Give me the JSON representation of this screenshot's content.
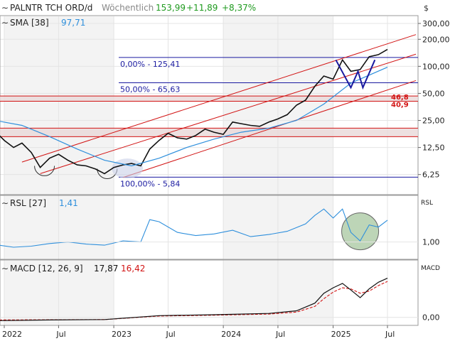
{
  "header": {
    "title": "PALNTR TCH ORD/d",
    "interval": "Wöchentlich",
    "price": "153,99",
    "change": "+11,89",
    "change_pct": "+8,37%",
    "currency": "$"
  },
  "colors": {
    "price": "#111111",
    "sma": "#2e8fdc",
    "channel": "#d21414",
    "fib": "#1a1aa0",
    "support_zone": "#e8d8d8",
    "rsl": "#2e8fdc",
    "macd": "#111111",
    "signal": "#d21414",
    "green": "#1e9a1e",
    "grid": "#e4e4e4"
  },
  "chart_data": [
    {
      "type": "line",
      "panel": "price",
      "scale": "log",
      "y_ticks": [
        6.25,
        12.5,
        25,
        50,
        100,
        200,
        300
      ],
      "y_tick_labels": [
        "6,25",
        "12,50",
        "25,00",
        "50,00",
        "100,00",
        "200,00",
        "300,00"
      ],
      "x_ticks": [
        "2022",
        "Jul",
        "2023",
        "Jul",
        "2024",
        "Jul",
        "2025",
        "Jul"
      ],
      "x_tick_dates": [
        "2022-01-01",
        "2022-07-01",
        "2023-01-01",
        "2023-07-01",
        "2024-01-01",
        "2024-07-01",
        "2025-01-01",
        "2025-07-01"
      ],
      "grid": true,
      "series": [
        {
          "name": "PALNTR TCH ORD/d",
          "x": [
            "2021-12-01",
            "2022-01-01",
            "2022-02-01",
            "2022-03-01",
            "2022-04-01",
            "2022-05-01",
            "2022-06-01",
            "2022-07-01",
            "2022-08-01",
            "2022-09-01",
            "2022-10-01",
            "2022-11-01",
            "2022-12-01",
            "2023-01-01",
            "2023-02-01",
            "2023-03-01",
            "2023-04-01",
            "2023-05-01",
            "2023-06-01",
            "2023-07-01",
            "2023-08-01",
            "2023-09-01",
            "2023-10-01",
            "2023-11-01",
            "2023-12-01",
            "2024-01-01",
            "2024-02-01",
            "2024-03-01",
            "2024-04-01",
            "2024-05-01",
            "2024-06-01",
            "2024-07-01",
            "2024-08-01",
            "2024-09-01",
            "2024-10-01",
            "2024-11-01",
            "2024-12-01",
            "2025-01-01",
            "2025-02-01",
            "2025-03-01",
            "2025-04-01",
            "2025-05-01",
            "2025-06-01",
            "2025-07-01"
          ],
          "y": [
            19,
            15,
            12.5,
            14,
            11,
            7.5,
            9.5,
            10.5,
            9,
            8,
            7.8,
            7.2,
            6.4,
            7.5,
            8,
            8.3,
            7.8,
            12,
            15,
            18,
            16,
            15.5,
            17,
            20,
            18.5,
            17.5,
            24,
            23,
            22,
            21.5,
            24,
            26,
            29,
            37,
            42,
            60,
            78,
            72,
            118,
            88,
            92,
            128,
            135,
            153.99
          ]
        },
        {
          "name": "SMA [38]",
          "value_label": "97,71",
          "x": [
            "2021-12-01",
            "2022-03-01",
            "2022-06-01",
            "2022-09-01",
            "2022-12-01",
            "2023-03-01",
            "2023-06-01",
            "2023-09-01",
            "2023-12-01",
            "2024-03-01",
            "2024-06-01",
            "2024-09-01",
            "2024-12-01",
            "2025-03-01",
            "2025-07-01"
          ],
          "y": [
            25,
            22,
            16.5,
            12,
            9,
            7.8,
            9.5,
            12.5,
            15.5,
            18.5,
            20.5,
            25,
            38,
            65,
            97.71
          ]
        }
      ],
      "fib_levels": [
        {
          "label": "0,00% - 125,41",
          "value": 125.41
        },
        {
          "label": "50,00% - 65,63",
          "value": 65.63
        },
        {
          "label": "100,00% - 5,84",
          "value": 5.84
        }
      ],
      "horizontal_zones": [
        {
          "low": 40.9,
          "high": 46.8,
          "labels": [
            "46,8",
            "40,9"
          ]
        },
        {
          "low": 16.5,
          "high": 20.5
        }
      ],
      "trend_channel": [
        {
          "from": [
            "2022-03-01",
            8.6
          ],
          "to": [
            "2025-07-01",
            195
          ]
        },
        {
          "from": [
            "2022-05-01",
            6.4
          ],
          "to": [
            "2025-07-01",
            118
          ]
        },
        {
          "from": [
            "2023-02-01",
            5.8
          ],
          "to": [
            "2025-07-01",
            60
          ]
        }
      ]
    },
    {
      "type": "line",
      "panel": "rsl",
      "series_label": "RSL [27]",
      "value_label": "1,41",
      "y_ticks": [
        1.0
      ],
      "y_tick_labels": [
        "1,00"
      ],
      "axis_label": "RSL",
      "series": [
        {
          "name": "RSL [27]",
          "x": [
            "2021-12-01",
            "2022-02-01",
            "2022-04-01",
            "2022-06-01",
            "2022-08-01",
            "2022-10-01",
            "2022-12-01",
            "2023-02-01",
            "2023-04-01",
            "2023-05-01",
            "2023-06-01",
            "2023-08-01",
            "2023-10-01",
            "2023-12-01",
            "2024-02-01",
            "2024-04-01",
            "2024-06-01",
            "2024-08-01",
            "2024-10-01",
            "2024-11-01",
            "2024-12-01",
            "2025-01-01",
            "2025-02-01",
            "2025-03-01",
            "2025-04-01",
            "2025-05-01",
            "2025-06-01",
            "2025-07-01"
          ],
          "y": [
            0.95,
            0.9,
            0.92,
            0.97,
            1.0,
            0.96,
            0.94,
            1.02,
            1.0,
            1.42,
            1.38,
            1.18,
            1.12,
            1.15,
            1.22,
            1.1,
            1.14,
            1.2,
            1.34,
            1.5,
            1.62,
            1.45,
            1.62,
            1.18,
            1.02,
            1.32,
            1.28,
            1.41
          ]
        }
      ]
    },
    {
      "type": "line",
      "panel": "macd",
      "series_label": "MACD [12, 26, 9]",
      "macd_value": "17,87",
      "signal_value": "16,42",
      "y_ticks": [
        0
      ],
      "y_tick_labels": [
        "0,00"
      ],
      "axis_label": "MACD",
      "series": [
        {
          "name": "MACD",
          "x": [
            "2021-12-01",
            "2022-06-01",
            "2022-12-01",
            "2023-06-01",
            "2023-12-01",
            "2024-06-01",
            "2024-09-01",
            "2024-11-01",
            "2024-12-01",
            "2025-01-01",
            "2025-02-01",
            "2025-03-01",
            "2025-04-01",
            "2025-05-01",
            "2025-06-01",
            "2025-07-01"
          ],
          "y": [
            -1.5,
            -1.2,
            -1.0,
            0.8,
            1.2,
            1.8,
            3.0,
            6.5,
            11.0,
            13.5,
            15.5,
            12.5,
            9.0,
            13.0,
            16.0,
            17.87
          ]
        },
        {
          "name": "Signal",
          "x": [
            "2021-12-01",
            "2022-06-01",
            "2022-12-01",
            "2023-06-01",
            "2023-12-01",
            "2024-06-01",
            "2024-09-01",
            "2024-11-01",
            "2024-12-01",
            "2025-01-01",
            "2025-02-01",
            "2025-03-01",
            "2025-04-01",
            "2025-05-01",
            "2025-06-01",
            "2025-07-01"
          ],
          "y": [
            -1.2,
            -1.1,
            -1.0,
            0.6,
            1.0,
            1.5,
            2.4,
            5.0,
            8.5,
            11.5,
            13.5,
            13.0,
            11.0,
            12.0,
            14.5,
            16.42
          ]
        }
      ]
    }
  ]
}
